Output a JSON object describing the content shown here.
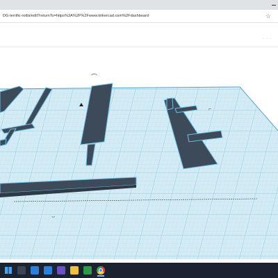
{
  "browser": {
    "url": "DG-terrific-rottis/edit?returnTo=https%3A%2F%2Fwww.tinkercad.com%2Fdashboard"
  },
  "workplane": {
    "grid_color": "#a9d6e6",
    "plane_color": "#cfe8f2",
    "edge_color": "#5aa3c4",
    "object_color": "#3c4a59",
    "object_edge_color": "#6fc2e6"
  },
  "taskbar": {
    "icons": [
      "windows-start-icon",
      "search-icon",
      "task-view-icon",
      "edge-icon",
      "teams-icon",
      "file-explorer-icon",
      "excel-icon",
      "chrome-icon"
    ]
  }
}
